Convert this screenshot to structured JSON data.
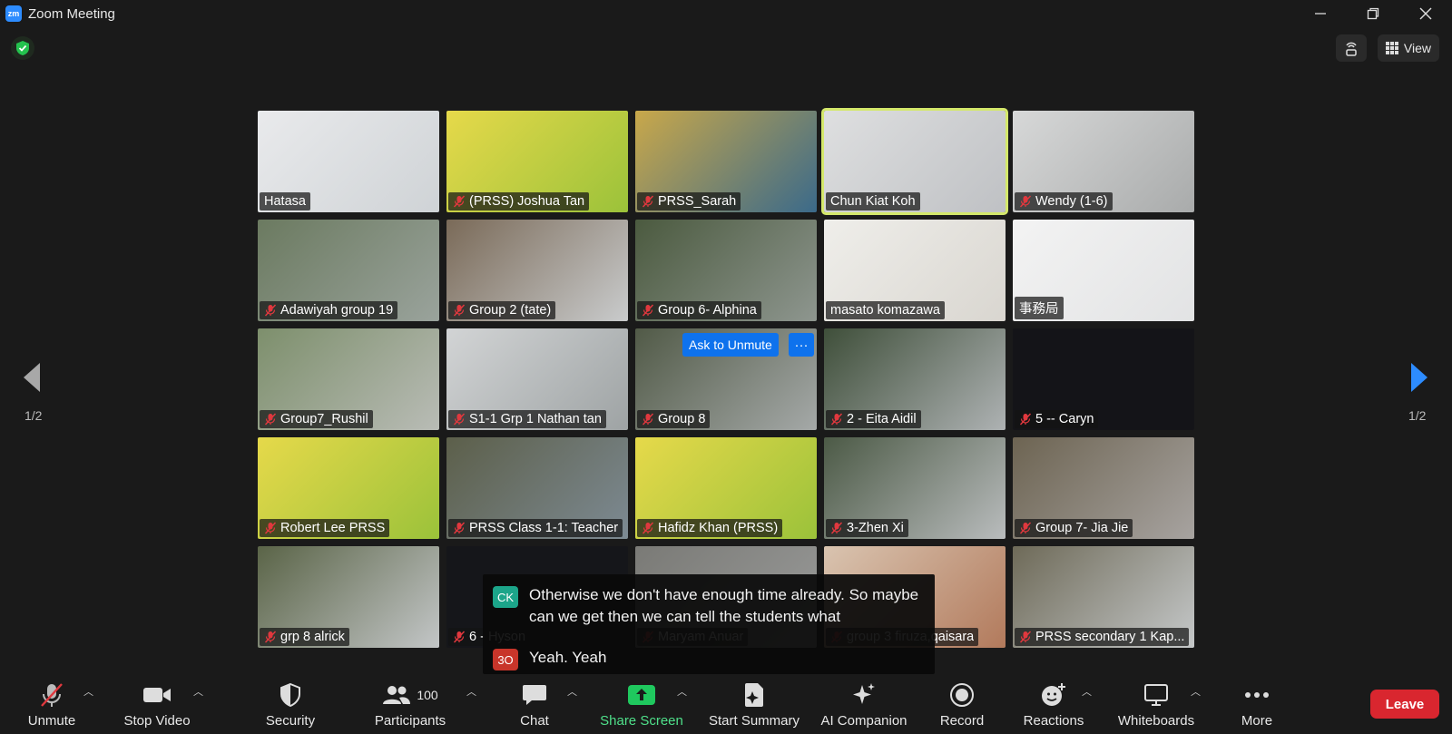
{
  "window": {
    "title": "Zoom Meeting",
    "logo_text": "zm"
  },
  "top_right": {
    "view_label": "View"
  },
  "participants": [
    {
      "name": "Hatasa",
      "muted": false,
      "bg": "#cfd3d6",
      "bg2": "#e9eaec"
    },
    {
      "name": "(PRSS) Joshua Tan",
      "muted": true,
      "bg": "#9bc23a",
      "bg2": "#e6d94a"
    },
    {
      "name": "PRSS_Sarah",
      "muted": true,
      "bg": "#3b6a8a",
      "bg2": "#c9a84a"
    },
    {
      "name": "Chun Kiat Koh",
      "muted": false,
      "bg": "#bfc1c4",
      "bg2": "#dedfe0"
    },
    {
      "name": "Wendy (1-6)",
      "muted": true,
      "bg": "#a9abab",
      "bg2": "#d7d8d8"
    },
    {
      "name": "Adawiyah group 19",
      "muted": true,
      "bg": "#9aa39c",
      "bg2": "#6b7a60"
    },
    {
      "name": "Group 2 (tate)",
      "muted": true,
      "bg": "#c9cbcc",
      "bg2": "#7a6a58"
    },
    {
      "name": "Group 6- Alphina",
      "muted": true,
      "bg": "#8e968f",
      "bg2": "#4b5a3f"
    },
    {
      "name": "masato komazawa",
      "muted": false,
      "bg": "#d9d6d0",
      "bg2": "#efeeea"
    },
    {
      "name": "事務局",
      "muted": false,
      "bg": "#e2e3e4",
      "bg2": "#f3f3f3"
    },
    {
      "name": "Group7_Rushil",
      "muted": true,
      "bg": "#b9bcb6",
      "bg2": "#7d8f6c"
    },
    {
      "name": "S1-1 Grp 1 Nathan tan",
      "muted": true,
      "bg": "#9ea3a4",
      "bg2": "#d2d4d5"
    },
    {
      "name": "Group 8",
      "muted": true,
      "bg": "#a5a9a8",
      "bg2": "#515a47"
    },
    {
      "name": "2 - Eita Aidil",
      "muted": true,
      "bg": "#aeb2b3",
      "bg2": "#3f4f3a"
    },
    {
      "name": "5 -- Caryn",
      "muted": true,
      "bg": "#141418",
      "bg2": "#141418"
    },
    {
      "name": "Robert Lee PRSS",
      "muted": true,
      "bg": "#9bc23a",
      "bg2": "#e6d94a"
    },
    {
      "name": "PRSS Class 1-1: Teacher",
      "muted": true,
      "bg": "#7d8a93",
      "bg2": "#5c5f4a"
    },
    {
      "name": "Hafidz Khan (PRSS)",
      "muted": true,
      "bg": "#9bc23a",
      "bg2": "#e6d94a"
    },
    {
      "name": "3-Zhen Xi",
      "muted": true,
      "bg": "#b9bcbd",
      "bg2": "#4c5a46"
    },
    {
      "name": "Group 7- Jia Jie",
      "muted": true,
      "bg": "#a7a3a0",
      "bg2": "#6d6452"
    },
    {
      "name": "grp 8 alrick",
      "muted": true,
      "bg": "#c3c6c7",
      "bg2": "#5a6447"
    },
    {
      "name": "6 - Hyson",
      "muted": true,
      "bg": "#15161a",
      "bg2": "#15161a"
    },
    {
      "name": "Maryam Anuar",
      "muted": true,
      "bg": "#9a9b9a",
      "bg2": "#7a7a76"
    },
    {
      "name": "group 3 firuza,qaisara",
      "muted": true,
      "bg": "#b27a5c",
      "bg2": "#d9c4b0"
    },
    {
      "name": "PRSS secondary 1 Kap...",
      "muted": true,
      "bg": "#c5c8c9",
      "bg2": "#6e6a58"
    }
  ],
  "ask_unmute": {
    "label": "Ask to Unmute",
    "more": "···"
  },
  "captions": [
    {
      "initials": "CK",
      "color": "#1ca58a",
      "text": "Otherwise we don't have enough time already. So maybe can we get then we can tell the students what"
    },
    {
      "initials": "3O",
      "color": "#c8352a",
      "text": "Yeah. Yeah"
    }
  ],
  "pagination": {
    "left": "1/2",
    "right": "1/2"
  },
  "toolbar": {
    "unmute": "Unmute",
    "stop_video": "Stop Video",
    "security": "Security",
    "participants": "Participants",
    "participant_count": "100",
    "chat": "Chat",
    "share_screen": "Share Screen",
    "start_summary": "Start Summary",
    "ai_companion": "AI Companion",
    "record": "Record",
    "reactions": "Reactions",
    "whiteboards": "Whiteboards",
    "more": "More",
    "leave": "Leave"
  }
}
